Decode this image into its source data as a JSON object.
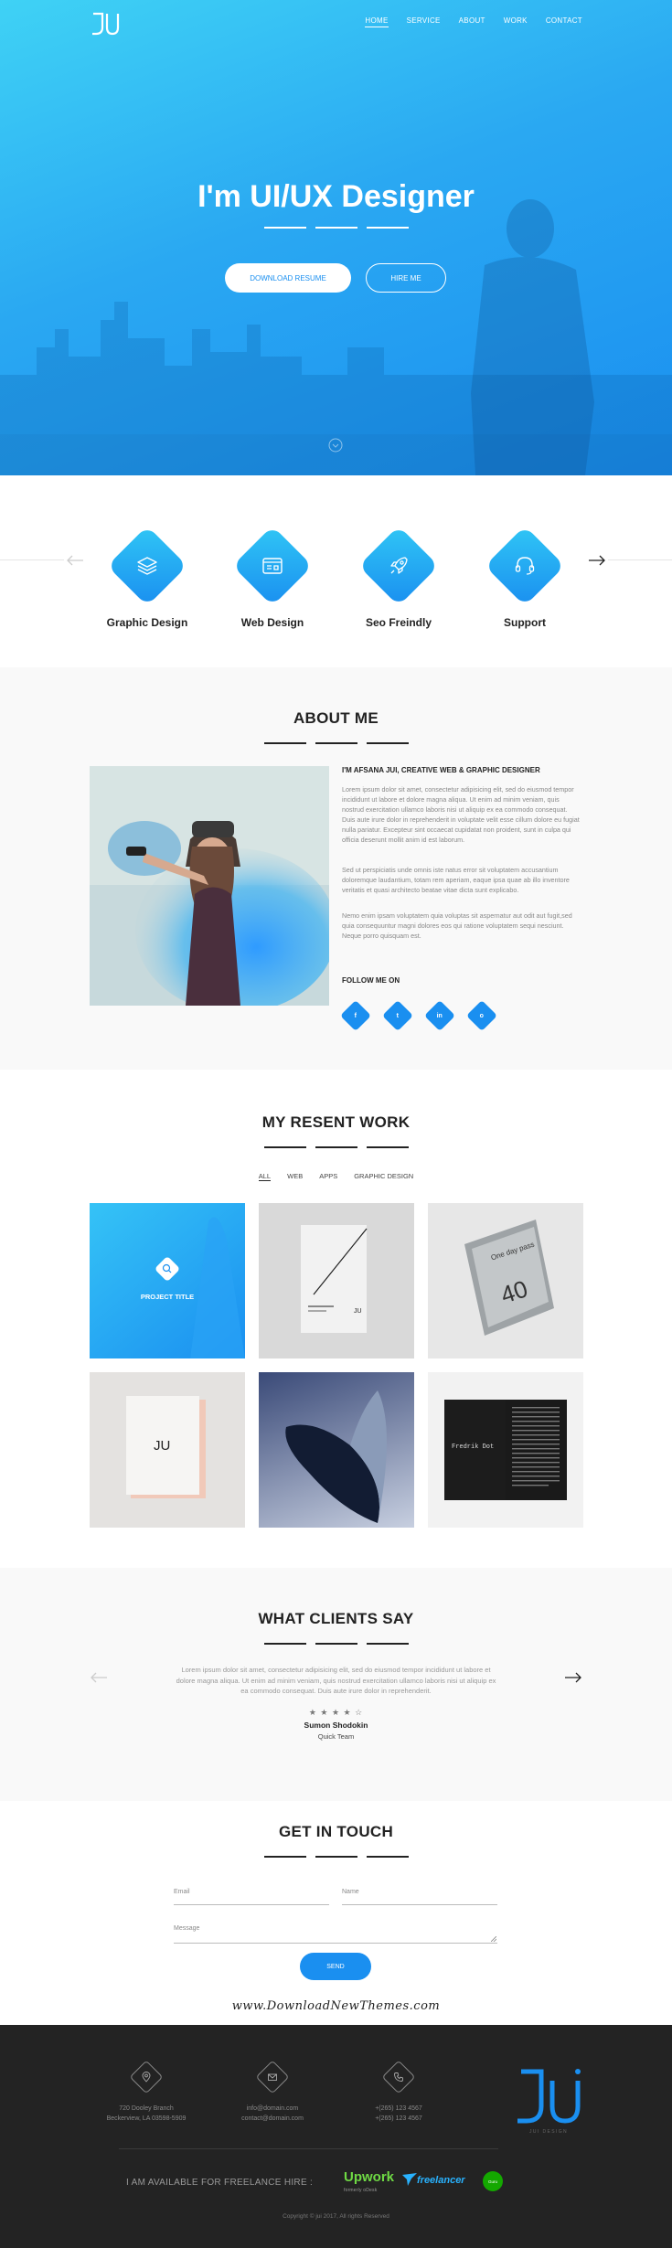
{
  "nav": {
    "items": [
      "HOME",
      "SERVICE",
      "ABOUT",
      "WORK",
      "CONTACT"
    ],
    "active": "HOME"
  },
  "hero": {
    "title": "I'm UI/UX Designer",
    "btn_resume": "DOWNLOAD RESUME",
    "btn_hire": "HIRE ME"
  },
  "services": [
    {
      "label": "Graphic Design",
      "icon": "layers-icon"
    },
    {
      "label": "Web Design",
      "icon": "browser-icon"
    },
    {
      "label": "Seo Freindly",
      "icon": "rocket-icon"
    },
    {
      "label": "Support",
      "icon": "headset-icon"
    }
  ],
  "about": {
    "title": "ABOUT ME",
    "heading": "I'M AFSANA JUI, CREATIVE WEB & GRAPHIC DESIGNER",
    "p1": "Lorem ipsum dolor sit amet, consectetur adipisicing elit, sed do eiusmod tempor incididunt ut labore et dolore magna aliqua. Ut enim ad minim veniam, quis nostrud exercitation ullamco laboris nisi ut aliquip ex ea commodo consequat. Duis aute irure dolor in reprehenderit in voluptate velit esse cillum dolore eu fugiat nulla pariatur. Excepteur sint occaecat cupidatat non proident, sunt in culpa qui officia deserunt mollit anim id est laborum.",
    "p2": "Sed ut perspiciatis unde omnis iste natus error sit voluptatem accusantium doloremque laudantium, totam rem aperiam, eaque ipsa quae ab illo inventore veritatis et quasi architecto beatae vitae dicta sunt explicabo.",
    "p3": "Nemo enim ipsam voluptatem quia voluptas sit aspernatur aut odit aut fugit,sed quia consequuntur magni dolores eos qui ratione voluptatem sequi nesciunt. Neque porro quisquam est.",
    "follow": "FOLLOW ME ON",
    "socials": [
      "f",
      "t",
      "in",
      "o"
    ]
  },
  "work": {
    "title": "MY RESENT WORK",
    "filters": [
      "ALL",
      "WEB",
      "APPS",
      "GRAPHIC DESIGN"
    ],
    "active_filter": "ALL",
    "project_title": "PROJECT TITLE",
    "card_a_text": "One day pass",
    "card_a_num": "40",
    "card_b_text": "JU",
    "card_c_text": "Fredrik Dot"
  },
  "clients": {
    "title": "WHAT CLIENTS SAY",
    "quote": "Lorem ipsum dolor sit amet, consectetur adipisicing elit, sed do eiusmod tempor incididunt ut labore et dolore magna aliqua. Ut enim ad minim veniam, quis nostrud exercitation ullamco laboris nisi ut aliquip ex ea commodo consequat. Duis aute irure dolor in reprehenderit.",
    "rating": 4.5,
    "stars": "★ ★ ★ ★ ☆",
    "name": "Sumon Shodokin",
    "company": "Quick Team"
  },
  "contact": {
    "title": "GET IN TOUCH",
    "email_placeholder": "Email",
    "name_placeholder": "Name",
    "message_placeholder": "Message",
    "send": "SEND",
    "watermark": "www.DownloadNewThemes.com"
  },
  "footer": {
    "address": [
      "720 Dooley Branch",
      "Beckerview, LA 03598-5909"
    ],
    "email": [
      "info@domain.com",
      "contact@domain.com"
    ],
    "phone": [
      "+(265) 123 4567",
      "+(265) 123 4567"
    ],
    "brand_tag": "JUI DESIGN",
    "hire": "I AM AVAILABLE FOR FREELANCE HIRE :",
    "upwork": "Upwork",
    "upwork_sub": "formerly oDesk",
    "freelancer": "freelancer",
    "guru": "Guru",
    "copyright": "Copyright © jui 2017, All rights Reserved"
  },
  "colors": {
    "accent": "#1a8ff0",
    "accent_light": "#3fd2f5",
    "footer_bg": "#232323"
  }
}
